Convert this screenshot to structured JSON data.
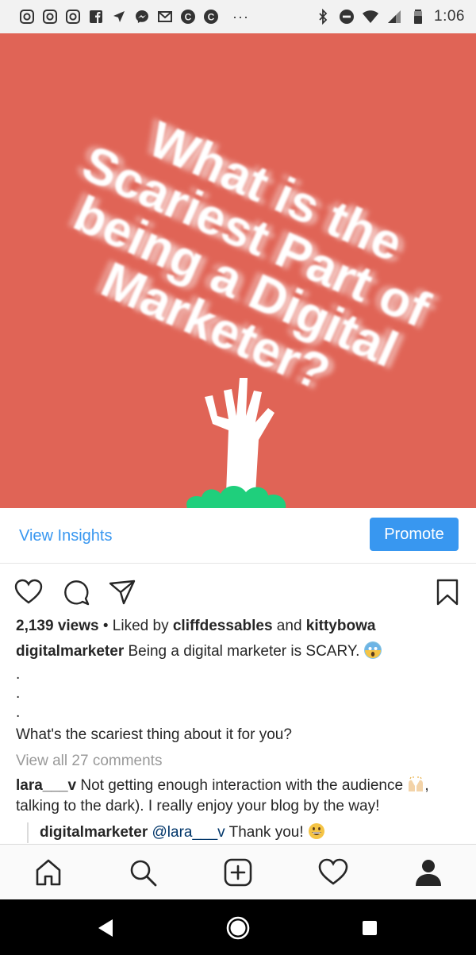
{
  "status_bar": {
    "time": "1:06",
    "more_indicator": "···",
    "icons": [
      "instagram-icon",
      "instagram-icon",
      "instagram-icon",
      "facebook-icon",
      "navigation-icon",
      "messenger-icon",
      "gmail-icon",
      "c-app-icon",
      "c-app-icon",
      "bluetooth-icon",
      "do-not-disturb-icon",
      "wifi-icon",
      "signal-icon",
      "battery-icon"
    ]
  },
  "post": {
    "image_text_lines": [
      "What is the",
      "Scariest Part of",
      "being a Digital",
      "Marketer?"
    ],
    "image_background": "#e06456"
  },
  "insights": {
    "view_label": "View Insights",
    "promote_label": "Promote",
    "accent": "#3897f0"
  },
  "stats": {
    "views": "2,139 views",
    "liked_by_prefix": " • Liked by ",
    "user1": "cliffdessables",
    "and": " and ",
    "user2": "kittybowa"
  },
  "caption": {
    "username": "digitalmarketer",
    "text": " Being a digital marketer is SCARY. ",
    "dots": [
      ".",
      ".",
      "."
    ],
    "question": "What's the scariest thing about it for you?"
  },
  "comments": {
    "view_all": "View all 27 comments",
    "c1_user": "lara___v",
    "c1_text": " Not getting enough interaction with the audience ",
    "c1_text_end": ",",
    "c1_line2": "talking to the dark). I really enjoy your blog by the way!",
    "reply_user": "digitalmarketer",
    "reply_mention": " @lara___v",
    "reply_text": " Thank you! "
  },
  "nav": {
    "icons": [
      "home-icon",
      "search-icon",
      "new-post-icon",
      "activity-heart-icon",
      "profile-icon"
    ]
  },
  "android_nav": {
    "icons": [
      "back-icon",
      "home-circle-icon",
      "recents-icon"
    ]
  }
}
